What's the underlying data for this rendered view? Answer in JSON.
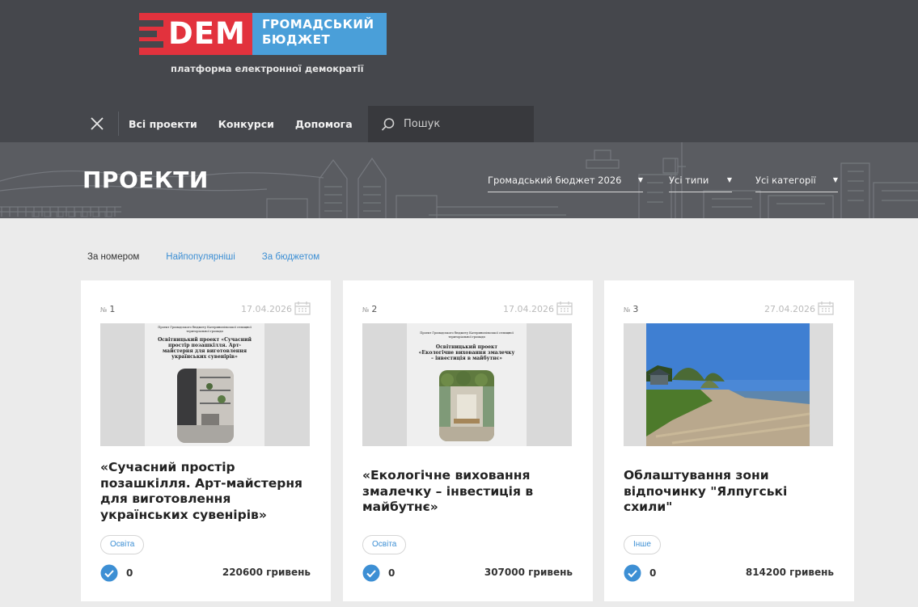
{
  "header": {
    "logo": {
      "dem": "DEM",
      "line1": "ГРОМАДСЬКИЙ",
      "line2": "БЮДЖЕТ",
      "subtitle": "платформа електронної демократії"
    },
    "nav": {
      "links": [
        "Всі проекти",
        "Конкурси",
        "Допомога"
      ],
      "close_icon": "close-icon"
    },
    "search": {
      "placeholder": "Пошук",
      "icon": "search-icon"
    }
  },
  "hero": {
    "title": "ПРОЕКТИ",
    "filters": {
      "budget": "Громадський бюджет 2026",
      "type": "Усі типи",
      "category": "Усі категорії"
    }
  },
  "sort": {
    "by_number": "За номером",
    "popular": "Найпопулярніші",
    "by_budget": "За бюджетом"
  },
  "colors": {
    "header": "#45474c",
    "accent_red": "#e2323d",
    "accent_blue": "#4a9fd9",
    "link": "#3d8fd4"
  },
  "projects": [
    {
      "num_prefix": "№",
      "num": "1",
      "date": "17.04.2026",
      "title": "«Сучасний простір позашкілля. Арт-майстерня для виготовлення українських сувенірів»",
      "tag": "Освіта",
      "votes": "0",
      "budget": "220600 гривень",
      "image": {
        "top": "Проект Громадського бюджету Катеринопільської селищної територіальної громади",
        "heading": "Освітницький проект «Сучасний простір позашкілля. Арт-майстерня для виготовлення українських сувенірів»"
      }
    },
    {
      "num_prefix": "№",
      "num": "2",
      "date": "17.04.2026",
      "title": "«Екологічне виховання змалечку – інвестиція в майбутнє»",
      "tag": "Освіта",
      "votes": "0",
      "budget": "307000 гривень",
      "image": {
        "top": "Проект Громадського бюджету Катеринопільської селищної територіальної громади",
        "heading": "Освітницький проект «Екологічне виховання змалечку – інвестиція в майбутнє»"
      }
    },
    {
      "num_prefix": "№",
      "num": "3",
      "date": "27.04.2026",
      "title": "Облаштування зони відпочинку \"Ялпугські схили\"",
      "tag": "Інше",
      "votes": "0",
      "budget": "814200 гривень",
      "image": {}
    }
  ]
}
